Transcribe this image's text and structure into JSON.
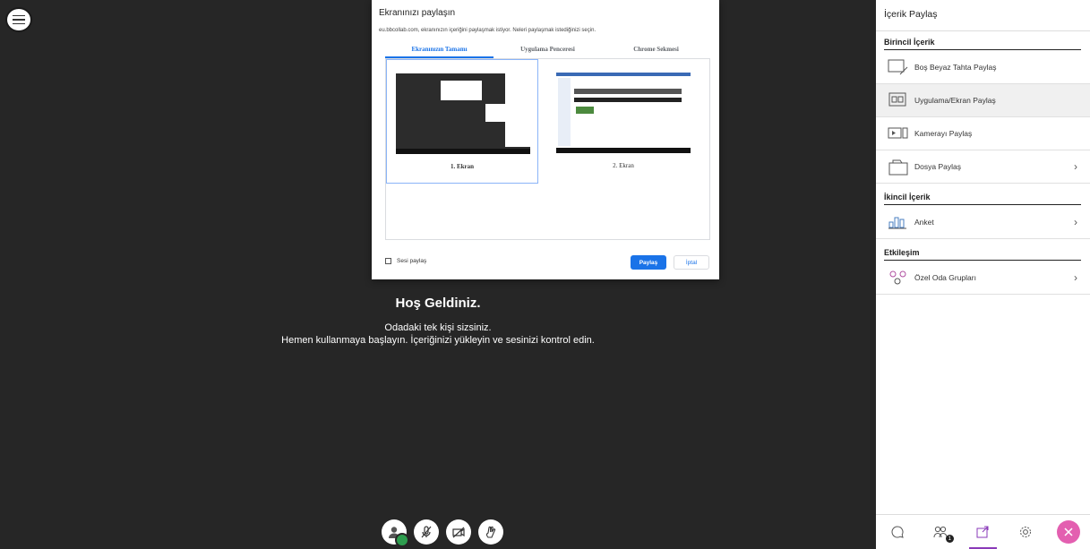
{
  "stage": {
    "welcome_title": "Hoş Geldiniz.",
    "welcome_line1": "Odadaki tek kişi sizsiniz.",
    "welcome_line2": "Hemen kullanmaya başlayın. İçeriğinizi yükleyin ve sesinizi kontrol edin."
  },
  "dialog": {
    "title": "Ekranınızı paylaşın",
    "subtitle": "eu.bbcollab.com, ekranınızın içeriğini paylaşmak istiyor. Neleri paylaşmak istediğinizi seçin.",
    "tabs": [
      {
        "label": "Ekranınızın Tamamı"
      },
      {
        "label": "Uygulama Penceresi"
      },
      {
        "label": "Chrome Sekmesi"
      }
    ],
    "screens": [
      {
        "label": "1. Ekran"
      },
      {
        "label": "2. Ekran"
      }
    ],
    "audio_label": "Sesi paylaş",
    "share_button": "Paylaş",
    "cancel_button": "İptal"
  },
  "side": {
    "title": "İçerik Paylaş",
    "primary_section": "Birincil İçerik",
    "primary_items": [
      {
        "label": "Boş Beyaz Tahta Paylaş"
      },
      {
        "label": "Uygulama/Ekran Paylaş"
      },
      {
        "label": "Kamerayı Paylaş"
      },
      {
        "label": "Dosya Paylaş"
      }
    ],
    "secondary_section": "İkincil İçerik",
    "secondary_items": [
      {
        "label": "Anket"
      }
    ],
    "interaction_section": "Etkileşim",
    "interaction_items": [
      {
        "label": "Özel Oda Grupları"
      }
    ],
    "participants_badge": "1"
  },
  "colors": {
    "stage_bg": "#262626",
    "accent_blue": "#1a73e8",
    "close_pink": "#e35fb0",
    "active_purple": "#8a3ab9"
  }
}
